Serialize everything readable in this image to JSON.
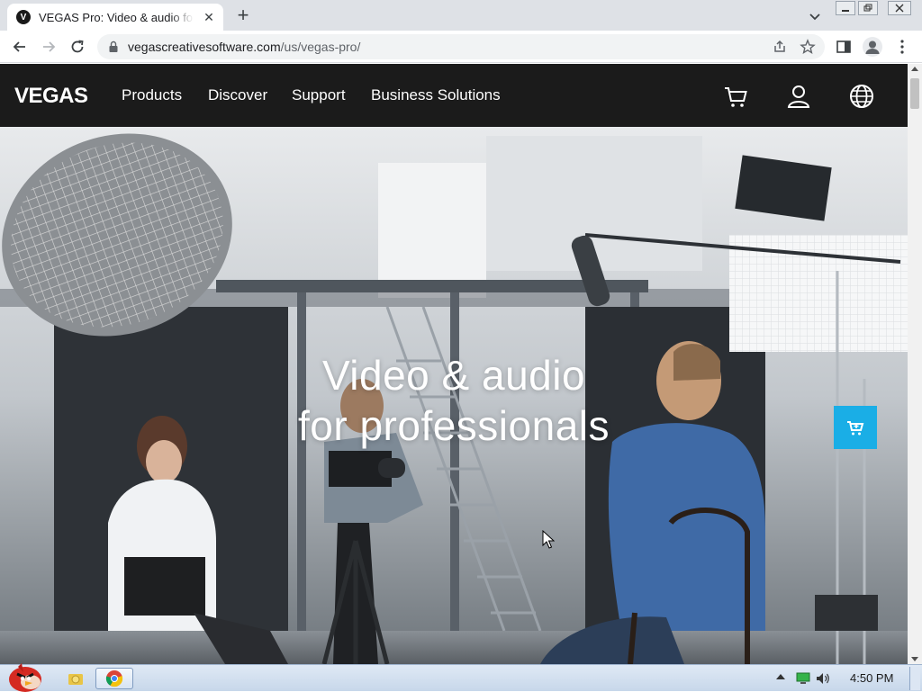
{
  "browser": {
    "tab_title": "VEGAS Pro: Video & audio for professionals",
    "tab_favicon_letter": "V",
    "url_host": "vegascreativesoftware.com",
    "url_path": "/us/vegas-pro/"
  },
  "site": {
    "logo": "VEGAS",
    "nav": {
      "products": "Products",
      "discover": "Discover",
      "support": "Support",
      "business": "Business Solutions"
    },
    "hero": {
      "line1": "Video & audio",
      "line2": "for professionals"
    }
  },
  "taskbar": {
    "clock": "4:50 PM"
  },
  "colors": {
    "nav_bg": "#1b1b1b",
    "accent": "#1aaee6"
  },
  "icons": {
    "cart": "cart-icon",
    "account": "user-icon",
    "language": "globe-icon"
  }
}
